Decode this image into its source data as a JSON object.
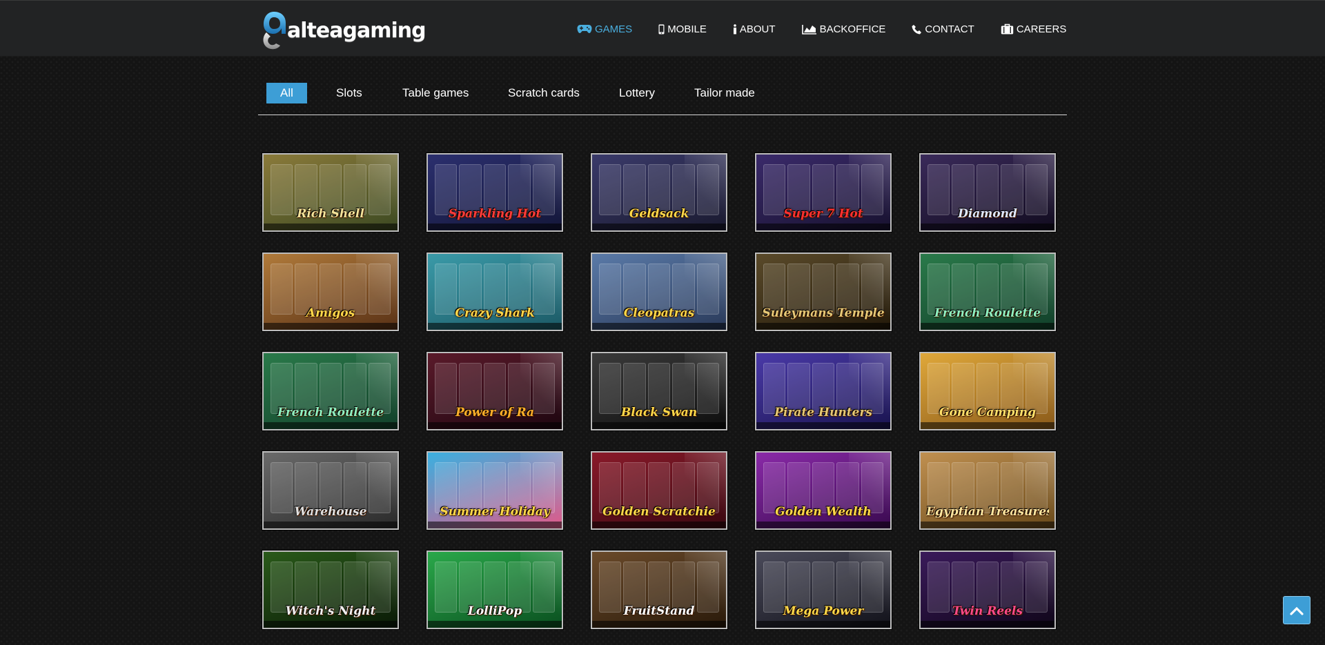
{
  "brand": {
    "logo_text_1": "altea",
    "logo_text_2": "gaming"
  },
  "nav": [
    {
      "label": "GAMES",
      "icon": "gamepad-icon",
      "active": true
    },
    {
      "label": "MOBILE",
      "icon": "mobile-icon",
      "active": false
    },
    {
      "label": "ABOUT",
      "icon": "info-icon",
      "active": false
    },
    {
      "label": "BACKOFFICE",
      "icon": "area-chart-icon",
      "active": false
    },
    {
      "label": "CONTACT",
      "icon": "phone-icon",
      "active": false
    },
    {
      "label": "CAREERS",
      "icon": "briefcase-icon",
      "active": false
    }
  ],
  "filters": [
    {
      "label": "All",
      "active": true
    },
    {
      "label": "Slots",
      "active": false
    },
    {
      "label": "Table games",
      "active": false
    },
    {
      "label": "Scratch cards",
      "active": false
    },
    {
      "label": "Lottery",
      "active": false
    },
    {
      "label": "Tailor made",
      "active": false
    }
  ],
  "games": [
    {
      "title": "Rich Shell",
      "bg": [
        "#8a7a3a",
        "#3d4a22"
      ],
      "accent": "#f3e39a"
    },
    {
      "title": "Sparkling Hot",
      "bg": [
        "#2b2f6e",
        "#14173a"
      ],
      "accent": "#ff3b3b"
    },
    {
      "title": "Geldsack",
      "bg": [
        "#3a3a6a",
        "#1a1a30"
      ],
      "accent": "#ffd84a"
    },
    {
      "title": "Super 7 Hot",
      "bg": [
        "#3a2a6a",
        "#181230"
      ],
      "accent": "#ff3030"
    },
    {
      "title": "Diamond",
      "bg": [
        "#3a2a5a",
        "#120c20"
      ],
      "accent": "#dfe8ff"
    },
    {
      "title": "Amigos",
      "bg": [
        "#b07a3a",
        "#5a3216"
      ],
      "accent": "#ffd84a"
    },
    {
      "title": "Crazy Shark",
      "bg": [
        "#3a9aa8",
        "#1c5a66"
      ],
      "accent": "#ffd84a"
    },
    {
      "title": "Cleopatras",
      "bg": [
        "#5a7aa8",
        "#2a3a5a"
      ],
      "accent": "#ffd84a"
    },
    {
      "title": "Suleymans Temple",
      "bg": [
        "#5a4a2a",
        "#241a0a"
      ],
      "accent": "#e6c876"
    },
    {
      "title": "French Roulette",
      "bg": [
        "#2a7a4a",
        "#12402a"
      ],
      "accent": "#8ff0c0"
    },
    {
      "title": "French Roulette",
      "bg": [
        "#2a7a4a",
        "#12402a"
      ],
      "accent": "#8ff0c0"
    },
    {
      "title": "Power of Ra",
      "bg": [
        "#5a1a2a",
        "#1e0610"
      ],
      "accent": "#ffb02a"
    },
    {
      "title": "Black Swan",
      "bg": [
        "#3a3a3a",
        "#0e0e0e"
      ],
      "accent": "#ffd84a"
    },
    {
      "title": "Pirate Hunters",
      "bg": [
        "#4a3aa8",
        "#1a1450"
      ],
      "accent": "#e6c876"
    },
    {
      "title": "Gone Camping",
      "bg": [
        "#e0a83a",
        "#8a5a1a"
      ],
      "accent": "#ffe06a"
    },
    {
      "title": "Warehouse",
      "bg": [
        "#6a6a6a",
        "#2a2a2a"
      ],
      "accent": "#e0e0e0"
    },
    {
      "title": "Summer Holiday",
      "bg": [
        "#3ab0e0",
        "#e05a8a"
      ],
      "accent": "#ffd84a"
    },
    {
      "title": "Golden Scratchie",
      "bg": [
        "#8a1a2a",
        "#3a0810"
      ],
      "accent": "#ffd84a"
    },
    {
      "title": "Golden Wealth",
      "bg": [
        "#8a2aa8",
        "#3a0a50"
      ],
      "accent": "#ffd84a"
    },
    {
      "title": "Egyptian Treasures",
      "bg": [
        "#c09050",
        "#6a4a1a"
      ],
      "accent": "#ffe6a0"
    },
    {
      "title": "Witch's Night",
      "bg": [
        "#2a5a1a",
        "#0a1a06"
      ],
      "accent": "#f0f0f0"
    },
    {
      "title": "LolliPop",
      "bg": [
        "#2aa84a",
        "#0a5020"
      ],
      "accent": "#ffffff"
    },
    {
      "title": "FruitStand",
      "bg": [
        "#6a4a2a",
        "#2a1a0a"
      ],
      "accent": "#ffffff"
    },
    {
      "title": "Mega Power",
      "bg": [
        "#4a4a5a",
        "#12121a"
      ],
      "accent": "#ffd84a"
    },
    {
      "title": "Twin Reels",
      "bg": [
        "#3a1a5a",
        "#10061a"
      ],
      "accent": "#ff4a8a"
    }
  ],
  "colors": {
    "accent": "#3d9ed6",
    "nav_active": "#4aaede",
    "header_bg": "#222324",
    "card_border": "#bdbdbd"
  },
  "scroll_top_icon": "chevron-up-icon"
}
